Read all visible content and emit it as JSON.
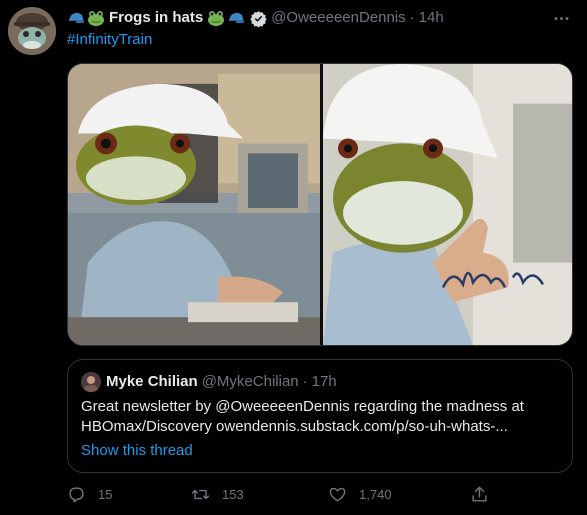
{
  "tweet": {
    "display_name": "Frogs in hats",
    "name_emojis": [
      "cap-emoji",
      "frog-emoji",
      "frog-emoji",
      "cap-emoji"
    ],
    "verified": true,
    "handle": "@OweeeeenDennis",
    "separator": "·",
    "time": "14h",
    "hashtag": "#InfinityTrain",
    "more_icon": "more-dots-icon"
  },
  "quote": {
    "name": "Myke Chilian",
    "handle": "@MykeChilian",
    "separator": "·",
    "time": "17h",
    "text_lines": [
      "Great newsletter by @OweeeeenDennis regarding the madness at",
      "HBOmax/Discovery owendennis.substack.com/p/so-uh-whats-..."
    ],
    "show_thread": "Show this thread"
  },
  "media": {
    "left_photo": "office-worker-frog-head-photo",
    "right_photo": "thumbs-up-frog-head-photo",
    "signature": "Brent Ram"
  },
  "actions": {
    "reply_count": "15",
    "retweet_count": "153",
    "like_count": "1,740"
  },
  "colors": {
    "background": "#000000",
    "text": "#e7e9ea",
    "muted": "#71767b",
    "accent": "#1d9bf0",
    "border": "#2f3336"
  }
}
